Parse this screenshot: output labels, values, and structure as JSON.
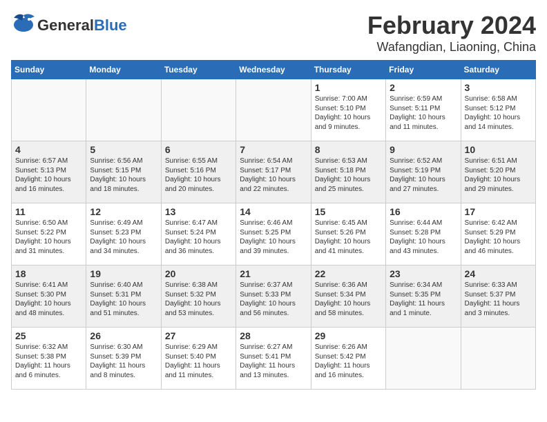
{
  "header": {
    "logo_general": "General",
    "logo_blue": "Blue",
    "month": "February 2024",
    "location": "Wafangdian, Liaoning, China"
  },
  "weekdays": [
    "Sunday",
    "Monday",
    "Tuesday",
    "Wednesday",
    "Thursday",
    "Friday",
    "Saturday"
  ],
  "weeks": [
    [
      {
        "day": "",
        "info": ""
      },
      {
        "day": "",
        "info": ""
      },
      {
        "day": "",
        "info": ""
      },
      {
        "day": "",
        "info": ""
      },
      {
        "day": "1",
        "info": "Sunrise: 7:00 AM\nSunset: 5:10 PM\nDaylight: 10 hours\nand 9 minutes."
      },
      {
        "day": "2",
        "info": "Sunrise: 6:59 AM\nSunset: 5:11 PM\nDaylight: 10 hours\nand 11 minutes."
      },
      {
        "day": "3",
        "info": "Sunrise: 6:58 AM\nSunset: 5:12 PM\nDaylight: 10 hours\nand 14 minutes."
      }
    ],
    [
      {
        "day": "4",
        "info": "Sunrise: 6:57 AM\nSunset: 5:13 PM\nDaylight: 10 hours\nand 16 minutes."
      },
      {
        "day": "5",
        "info": "Sunrise: 6:56 AM\nSunset: 5:15 PM\nDaylight: 10 hours\nand 18 minutes."
      },
      {
        "day": "6",
        "info": "Sunrise: 6:55 AM\nSunset: 5:16 PM\nDaylight: 10 hours\nand 20 minutes."
      },
      {
        "day": "7",
        "info": "Sunrise: 6:54 AM\nSunset: 5:17 PM\nDaylight: 10 hours\nand 22 minutes."
      },
      {
        "day": "8",
        "info": "Sunrise: 6:53 AM\nSunset: 5:18 PM\nDaylight: 10 hours\nand 25 minutes."
      },
      {
        "day": "9",
        "info": "Sunrise: 6:52 AM\nSunset: 5:19 PM\nDaylight: 10 hours\nand 27 minutes."
      },
      {
        "day": "10",
        "info": "Sunrise: 6:51 AM\nSunset: 5:20 PM\nDaylight: 10 hours\nand 29 minutes."
      }
    ],
    [
      {
        "day": "11",
        "info": "Sunrise: 6:50 AM\nSunset: 5:22 PM\nDaylight: 10 hours\nand 31 minutes."
      },
      {
        "day": "12",
        "info": "Sunrise: 6:49 AM\nSunset: 5:23 PM\nDaylight: 10 hours\nand 34 minutes."
      },
      {
        "day": "13",
        "info": "Sunrise: 6:47 AM\nSunset: 5:24 PM\nDaylight: 10 hours\nand 36 minutes."
      },
      {
        "day": "14",
        "info": "Sunrise: 6:46 AM\nSunset: 5:25 PM\nDaylight: 10 hours\nand 39 minutes."
      },
      {
        "day": "15",
        "info": "Sunrise: 6:45 AM\nSunset: 5:26 PM\nDaylight: 10 hours\nand 41 minutes."
      },
      {
        "day": "16",
        "info": "Sunrise: 6:44 AM\nSunset: 5:28 PM\nDaylight: 10 hours\nand 43 minutes."
      },
      {
        "day": "17",
        "info": "Sunrise: 6:42 AM\nSunset: 5:29 PM\nDaylight: 10 hours\nand 46 minutes."
      }
    ],
    [
      {
        "day": "18",
        "info": "Sunrise: 6:41 AM\nSunset: 5:30 PM\nDaylight: 10 hours\nand 48 minutes."
      },
      {
        "day": "19",
        "info": "Sunrise: 6:40 AM\nSunset: 5:31 PM\nDaylight: 10 hours\nand 51 minutes."
      },
      {
        "day": "20",
        "info": "Sunrise: 6:38 AM\nSunset: 5:32 PM\nDaylight: 10 hours\nand 53 minutes."
      },
      {
        "day": "21",
        "info": "Sunrise: 6:37 AM\nSunset: 5:33 PM\nDaylight: 10 hours\nand 56 minutes."
      },
      {
        "day": "22",
        "info": "Sunrise: 6:36 AM\nSunset: 5:34 PM\nDaylight: 10 hours\nand 58 minutes."
      },
      {
        "day": "23",
        "info": "Sunrise: 6:34 AM\nSunset: 5:35 PM\nDaylight: 11 hours\nand 1 minute."
      },
      {
        "day": "24",
        "info": "Sunrise: 6:33 AM\nSunset: 5:37 PM\nDaylight: 11 hours\nand 3 minutes."
      }
    ],
    [
      {
        "day": "25",
        "info": "Sunrise: 6:32 AM\nSunset: 5:38 PM\nDaylight: 11 hours\nand 6 minutes."
      },
      {
        "day": "26",
        "info": "Sunrise: 6:30 AM\nSunset: 5:39 PM\nDaylight: 11 hours\nand 8 minutes."
      },
      {
        "day": "27",
        "info": "Sunrise: 6:29 AM\nSunset: 5:40 PM\nDaylight: 11 hours\nand 11 minutes."
      },
      {
        "day": "28",
        "info": "Sunrise: 6:27 AM\nSunset: 5:41 PM\nDaylight: 11 hours\nand 13 minutes."
      },
      {
        "day": "29",
        "info": "Sunrise: 6:26 AM\nSunset: 5:42 PM\nDaylight: 11 hours\nand 16 minutes."
      },
      {
        "day": "",
        "info": ""
      },
      {
        "day": "",
        "info": ""
      }
    ]
  ]
}
